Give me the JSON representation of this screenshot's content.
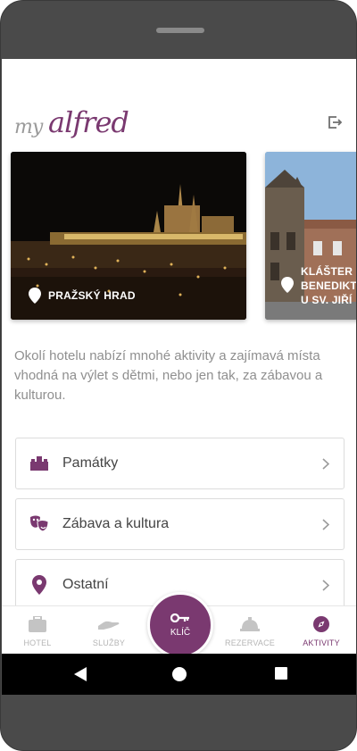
{
  "app": {
    "logo_my": "my",
    "logo_alfred": "alfred"
  },
  "header": {
    "logout_icon": "logout-icon"
  },
  "cards": [
    {
      "label": "PRAŽSKÝ HRAD",
      "icon": "map-pin-icon"
    },
    {
      "label": "KLÁŠTER BENEDIKTINŮ U SV. JIŘÍ",
      "icon": "map-pin-icon"
    }
  ],
  "description": "Okolí hotelu nabízí mnohé aktivity a zajímavá místa vhodná na výlet s dětmi, nebo jen tak, za zábavou a kulturou.",
  "categories": [
    {
      "label": "Památky",
      "icon": "monument-icon"
    },
    {
      "label": "Zábava a kultura",
      "icon": "theater-masks-icon"
    },
    {
      "label": "Ostatní",
      "icon": "map-marker-icon"
    }
  ],
  "tabs": [
    {
      "label": "HOTEL",
      "icon": "suitcase-icon"
    },
    {
      "label": "SLUŽBY",
      "icon": "hand-service-icon"
    },
    {
      "label": "KLÍČ",
      "icon": "key-icon"
    },
    {
      "label": "REZERVACE",
      "icon": "service-bell-icon"
    },
    {
      "label": "AKTIVITY",
      "icon": "compass-icon"
    }
  ],
  "colors": {
    "accent": "#7a3970",
    "text_muted": "#8f8f8f",
    "tab_inactive": "#b5b5b5"
  }
}
